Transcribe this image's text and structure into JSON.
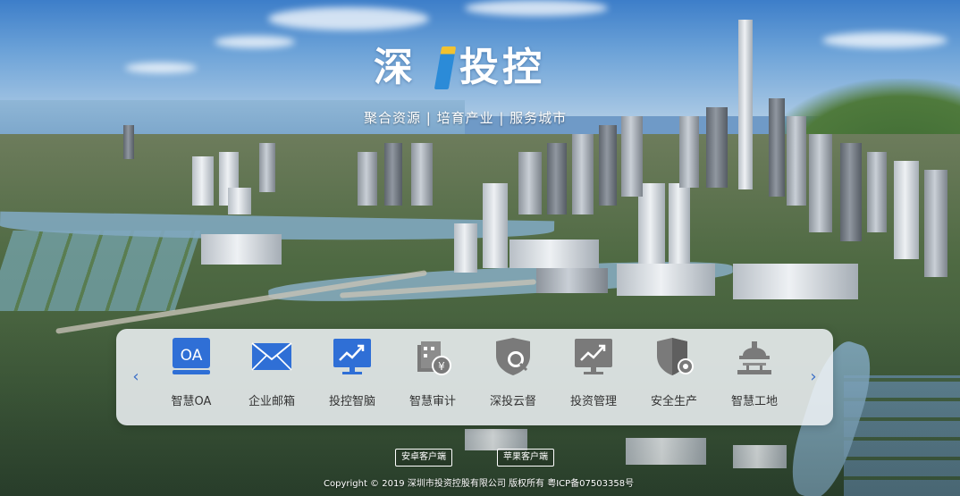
{
  "header": {
    "logo_text_1": "深",
    "logo_text_2": "投控",
    "slogan": "聚合资源 | 培育产业 | 服务城市"
  },
  "apps": [
    {
      "label": "智慧OA",
      "icon": "oa-icon",
      "badge_text": "OA",
      "color": "#2f6fd6"
    },
    {
      "label": "企业邮箱",
      "icon": "mail-icon",
      "color": "#2f6fd6"
    },
    {
      "label": "投控智脑",
      "icon": "chart-monitor-icon",
      "color": "#2f6fd6"
    },
    {
      "label": "智慧审计",
      "icon": "audit-icon",
      "color": "#7a7a7a"
    },
    {
      "label": "深投云督",
      "icon": "cloud-supervise-icon",
      "color": "#7a7a7a"
    },
    {
      "label": "投资管理",
      "icon": "investment-monitor-icon",
      "color": "#7a7a7a"
    },
    {
      "label": "安全生产",
      "icon": "safety-shield-icon",
      "color": "#7a7a7a"
    },
    {
      "label": "智慧工地",
      "icon": "construction-site-icon",
      "color": "#7a7a7a"
    }
  ],
  "nav": {
    "prev_icon": "chevron-left-icon",
    "next_icon": "chevron-right-icon",
    "prev_glyph": "‹",
    "next_glyph": "›"
  },
  "footer": {
    "android_client": "安卓客户端",
    "ios_client": "苹果客户端",
    "copyright": "Copyright © 2019 深圳市投资控股有限公司 版权所有 粤ICP备07503358号"
  }
}
